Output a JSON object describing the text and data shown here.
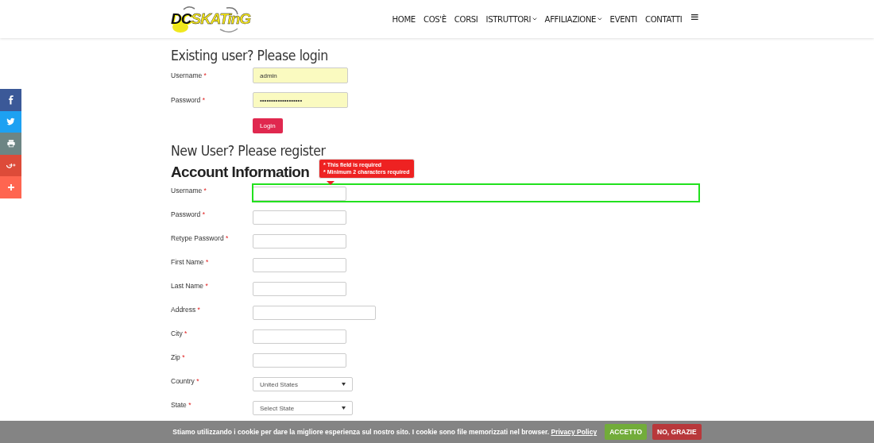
{
  "header": {
    "logo": {
      "part_1": "DC",
      "part_2": "SKATinG"
    },
    "nav": [
      {
        "label": "HOME",
        "dropdown": false
      },
      {
        "label": "COS'È",
        "dropdown": false
      },
      {
        "label": "CORSI",
        "dropdown": false
      },
      {
        "label": "ISTRUTTORI",
        "dropdown": true
      },
      {
        "label": "AFFILIAZIONE",
        "dropdown": true
      },
      {
        "label": "EVENTI",
        "dropdown": false
      },
      {
        "label": "CONTATTI",
        "dropdown": false
      },
      {
        "label": "≡",
        "dropdown": false
      }
    ]
  },
  "social_bar": [
    {
      "kind": "facebook",
      "color": "#3b5998"
    },
    {
      "kind": "twitter",
      "color": "#1da1f2"
    },
    {
      "kind": "print",
      "color": "#6d8584"
    },
    {
      "kind": "googleplus",
      "color": "#dd4b39"
    },
    {
      "kind": "more",
      "color": "#ff6550"
    }
  ],
  "login": {
    "title": "Existing user? Please login",
    "fields": [
      {
        "label": "Username",
        "required": "*",
        "value": "admin"
      },
      {
        "label": "Password",
        "required": "*",
        "value": "•••••••••••••••••••"
      }
    ],
    "button": "Login"
  },
  "register": {
    "title": "New User? Please register",
    "heading": "Account Information",
    "error_tooltip": [
      "* This field is required",
      "* Minimum 2 characters required"
    ],
    "fields": [
      {
        "label": "Username",
        "required": "*",
        "kind": "text",
        "highlighted": true
      },
      {
        "label": "Password",
        "required": "*",
        "kind": "text",
        "highlighted": false
      },
      {
        "label": "Retype Password",
        "required": "*",
        "kind": "text",
        "highlighted": false
      },
      {
        "label": "First Name",
        "required": "*",
        "kind": "text",
        "highlighted": false
      },
      {
        "label": "Last Name",
        "required": "*",
        "kind": "text",
        "highlighted": false
      },
      {
        "label": "Address",
        "required": "*",
        "kind": "wide",
        "highlighted": false
      },
      {
        "label": "City",
        "required": "*",
        "kind": "text",
        "highlighted": false
      },
      {
        "label": "Zip",
        "required": "*",
        "kind": "text",
        "highlighted": false
      },
      {
        "label": "Country",
        "required": "*",
        "kind": "select",
        "value": "United States",
        "highlighted": false
      },
      {
        "label": "State",
        "required": "*",
        "kind": "select",
        "value": "Select State",
        "highlighted": false
      }
    ]
  },
  "cookie_bar": {
    "text": "Stiamo utilizzando i cookie per dare la migliore esperienza sul nostro sito. I cookie sono file memorizzati nel browser.",
    "link": "Privacy Policy",
    "buttons": [
      {
        "label": "ACCETTO",
        "kind": "accept"
      },
      {
        "label": "NO, GRAZIE",
        "kind": "decline"
      }
    ]
  }
}
